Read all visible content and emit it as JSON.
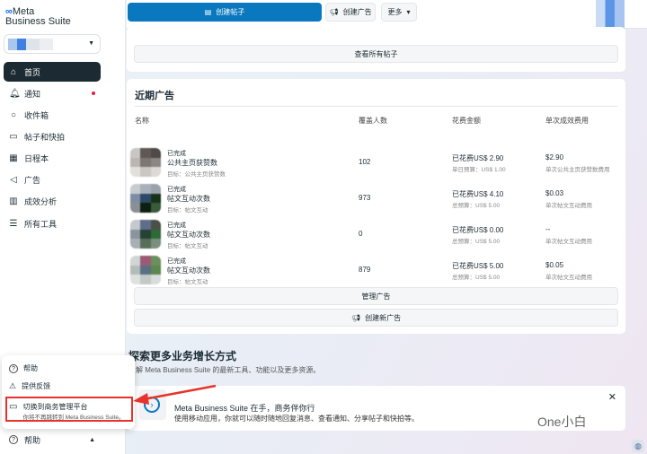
{
  "brand": {
    "line1": "Meta",
    "line2": "Business Suite"
  },
  "sidebar": {
    "items": [
      {
        "label": "首页",
        "icon": "home-icon"
      },
      {
        "label": "通知",
        "icon": "bell-icon"
      },
      {
        "label": "收件箱",
        "icon": "chat-icon"
      },
      {
        "label": "帖子和快拍",
        "icon": "posts-icon"
      },
      {
        "label": "日程本",
        "icon": "calendar-icon"
      },
      {
        "label": "广告",
        "icon": "megaphone-icon"
      },
      {
        "label": "成效分析",
        "icon": "bar-chart-icon"
      },
      {
        "label": "所有工具",
        "icon": "menu-icon"
      }
    ],
    "help": "帮助"
  },
  "topbar": {
    "create_post": "创建帖子",
    "create_ad": "创建广告",
    "more": "更多"
  },
  "posts": {
    "view_all": "查看所有帖子"
  },
  "ads": {
    "title": "近期广告",
    "columns": [
      "名称",
      "覆盖人数",
      "花费金额",
      "单次成效费用"
    ],
    "rows": [
      {
        "status": "已完成",
        "name": "公共主页获赞数",
        "goal": "目标：公共主页获赞数",
        "reach": "102",
        "spent": "已花费US$ 2.90",
        "budget": "单日预算：US$ 1.00",
        "cost": "$2.90",
        "cost_label": "单次公共主页获赞数费用"
      },
      {
        "status": "已完成",
        "name": "帖文互动次数",
        "goal": "目标：帖文互动",
        "reach": "973",
        "spent": "已花费US$ 4.10",
        "budget": "总预算：US$ 5.00",
        "cost": "$0.03",
        "cost_label": "单次帖文互动费用"
      },
      {
        "status": "已完成",
        "name": "帖文互动次数",
        "goal": "目标：帖文互动",
        "reach": "0",
        "spent": "已花费US$ 0.00",
        "budget": "总预算：US$ 5.00",
        "cost": "--",
        "cost_label": "单次帖文互动费用"
      },
      {
        "status": "已完成",
        "name": "帖文互动次数",
        "goal": "目标：帖文互动",
        "reach": "879",
        "spent": "已花费US$ 5.00",
        "budget": "总预算：US$ 5.00",
        "cost": "$0.05",
        "cost_label": "单次帖文互动费用"
      }
    ],
    "manage": "管理广告",
    "create_new": "创建新广告"
  },
  "explore": {
    "title": "探索更多业务增长方式",
    "subtitle": "了解 Meta Business Suite 的最新工具、功能以及更多资源。"
  },
  "promo": {
    "title": "Meta Business Suite 在手，商务伴你行",
    "body": "使用移动应用，你就可以随时随地回复消息、查看通知、分享帖子和快拍等。",
    "close": "✕"
  },
  "popup": {
    "help": "帮助",
    "feedback": "提供反馈",
    "switch": "切换到商务管理平台",
    "switch_sub": "你将不再跳转到 Meta Business Suite。"
  },
  "watermark": "One小白"
}
